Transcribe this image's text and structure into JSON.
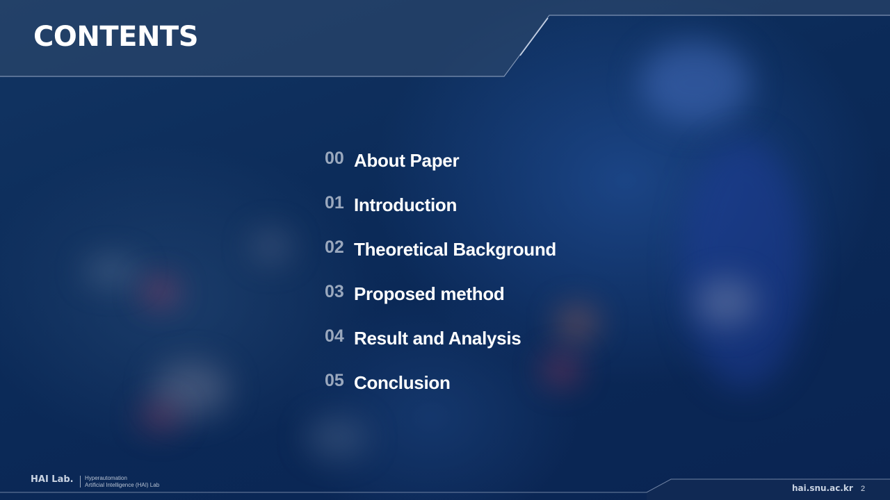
{
  "slide": {
    "title": "CONTENTS",
    "page_number": "2"
  },
  "toc": [
    {
      "num": "00",
      "label": "About Paper"
    },
    {
      "num": "01",
      "label": "Introduction"
    },
    {
      "num": "02",
      "label": "Theoretical Background"
    },
    {
      "num": "03",
      "label": "Proposed method"
    },
    {
      "num": "04",
      "label": "Result and Analysis"
    },
    {
      "num": "05",
      "label": "Conclusion"
    }
  ],
  "footer": {
    "brand": "HAI Lab.",
    "sub_line1": "Hyperautomation",
    "sub_line2": "Artificial Intelligence (HAI) Lab",
    "url": "hai.snu.ac.kr"
  },
  "colors": {
    "background": "#0d2d5c",
    "number": "#9aa8bd",
    "text": "#ffffff"
  }
}
